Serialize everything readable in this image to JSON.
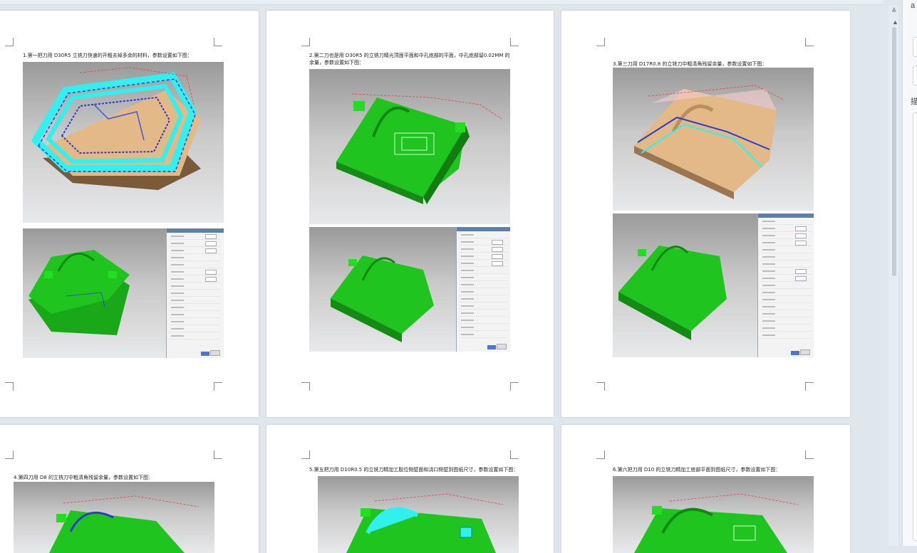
{
  "pages": [
    {
      "caption": "1.第一把刀用 D30R5 立铣刀快速的开粗去掉多余的材料，参数设置如下图："
    },
    {
      "caption": "2.第二刀也是用 D30R5 的立铣刀精光顶面平面和中孔底部的平面，中孔底部留0.02MM 的余量，参数设置如下图："
    },
    {
      "caption": "3.第三刀用 D17R0.8 的立铣刀中粗清角残留余量，参数设置如下图："
    },
    {
      "caption": "4.第四刀用 D8 的立铣刀中粗清角残留余量，参数设置如下图："
    },
    {
      "caption": "5.第五把刀用 D10R0.5 的立铣刀精加工胶位侧壁面和浇口侧壁到图纸尺寸，参数设置如下图："
    },
    {
      "caption": "6.第六把刀用 D10 的立铣刀精加工底部平面到图纸尺寸，参数设置如下图："
    }
  ],
  "right_panel": {
    "chars": [
      "a",
      "描"
    ]
  },
  "colors": {
    "part_green": "#1fc41f",
    "toolpath_cyan": "#31f0f0",
    "stock_tan": "#e3b987",
    "dialog_title": "#5e7fa6"
  }
}
